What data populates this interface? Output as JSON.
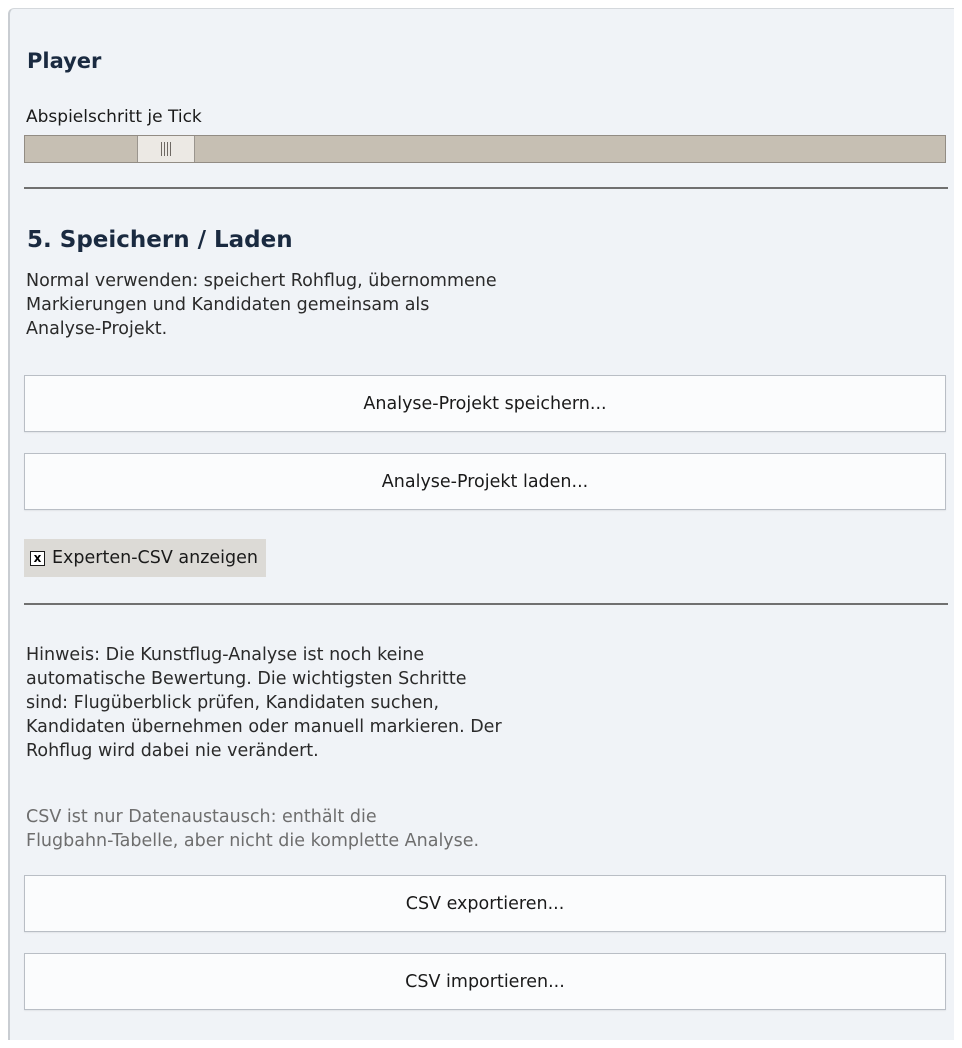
{
  "player": {
    "title": "Player",
    "slider_label": "Abspielschritt je Tick",
    "slider_value_fraction": 0.13
  },
  "save_load": {
    "title": "5. Speichern / Laden",
    "description": [
      "Normal verwenden: speichert Rohflug, übernommene",
      "Markierungen und Kandidaten gemeinsam als",
      "Analyse-Projekt."
    ],
    "save_button": "Analyse-Projekt speichern...",
    "load_button": "Analyse-Projekt laden...",
    "expert_csv_checkbox": {
      "label": "Experten-CSV anzeigen",
      "checked": true,
      "mark": "x"
    }
  },
  "hint": [
    "Hinweis: Die Kunstflug-Analyse ist noch keine",
    "automatische Bewertung. Die wichtigsten Schritte",
    "sind: Flugüberblick prüfen, Kandidaten suchen,",
    "Kandidaten übernehmen oder manuell markieren. Der",
    "Rohflug wird dabei nie verändert."
  ],
  "csv_note": [
    "CSV ist nur Datenaustausch: enthält die",
    "Flugbahn-Tabelle, aber nicht die komplette Analyse."
  ],
  "csv": {
    "export_button": "CSV exportieren...",
    "import_button": "CSV importieren..."
  }
}
